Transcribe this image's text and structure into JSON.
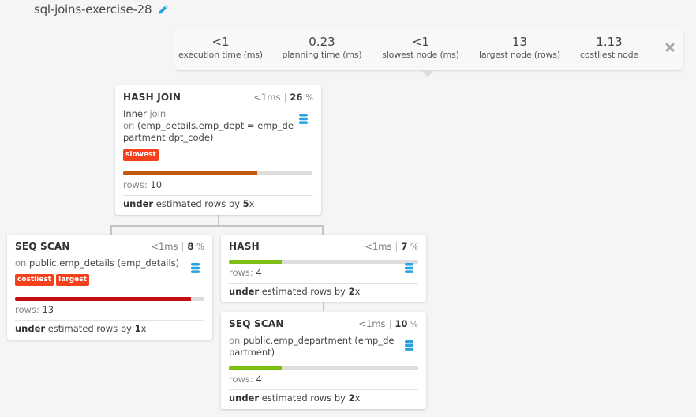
{
  "header": {
    "title": "sql-joins-exercise-28",
    "edit_icon": "pencil-icon"
  },
  "stats": [
    {
      "value": "<1",
      "label": "execution time (ms)"
    },
    {
      "value": "0.23",
      "label": "planning time (ms)"
    },
    {
      "value": "<1",
      "label": "slowest node (ms)"
    },
    {
      "value": "13",
      "label": "largest node (rows)"
    },
    {
      "value": "1.13",
      "label": "costliest node"
    }
  ],
  "close_icon": "close-icon",
  "nodes": {
    "hash_join": {
      "name": "HASH JOIN",
      "time_prefix": "<1",
      "time_unit": "ms",
      "percent": "26",
      "percent_sign": "%",
      "desc_line1_a": "Inner",
      "desc_line1_b": "join",
      "desc_on": "on",
      "desc_cond_1": "(emp_details.emp_dept = emp_de",
      "desc_cond_2": "partment.dpt_code)",
      "badges": [
        "slowest"
      ],
      "bar_fraction": 0.71,
      "bar_color": "#c0580f",
      "rows_label": "rows:",
      "rows": "10",
      "est_word": "under",
      "est_text": "estimated rows by",
      "est_factor": "5",
      "est_x": "x"
    },
    "seq_scan_details": {
      "name": "SEQ SCAN",
      "time_prefix": "<1",
      "time_unit": "ms",
      "percent": "8",
      "percent_sign": "%",
      "desc_on": "on",
      "desc_rel": "public.emp_details (emp_details)",
      "badges": [
        "costliest",
        "largest"
      ],
      "bar_fraction": 0.93,
      "bar_color": "#c00f0f",
      "rows_label": "rows:",
      "rows": "13",
      "est_word": "under",
      "est_text": "estimated rows by",
      "est_factor": "1",
      "est_x": "x"
    },
    "hash": {
      "name": "HASH",
      "time_prefix": "<1",
      "time_unit": "ms",
      "percent": "7",
      "percent_sign": "%",
      "bar_fraction": 0.28,
      "bar_color": "#7cbf12",
      "rows_label": "rows:",
      "rows": "4",
      "est_word": "under",
      "est_text": "estimated rows by",
      "est_factor": "2",
      "est_x": "x"
    },
    "seq_scan_department": {
      "name": "SEQ SCAN",
      "time_prefix": "<1",
      "time_unit": "ms",
      "percent": "10",
      "percent_sign": "%",
      "desc_on": "on",
      "desc_rel_1": "public.emp_department (emp_de",
      "desc_rel_2": "partment)",
      "bar_fraction": 0.28,
      "bar_color": "#7cbf12",
      "rows_label": "rows:",
      "rows": "4",
      "est_word": "under",
      "est_text": "estimated rows by",
      "est_factor": "2",
      "est_x": "x"
    }
  }
}
